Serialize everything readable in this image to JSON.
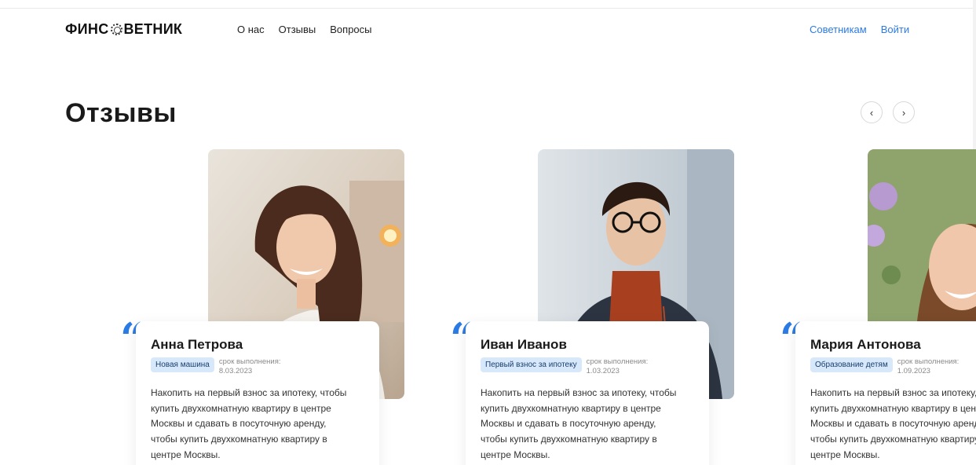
{
  "header": {
    "logo_left": "ФИНС",
    "logo_right": "ВЕТНИК",
    "nav": [
      "О нас",
      "Отзывы",
      "Вопросы"
    ],
    "nav_right": [
      "Советникам",
      "Войти"
    ]
  },
  "section": {
    "title": "Отзывы",
    "prev_icon": "‹",
    "next_icon": "›"
  },
  "reviews": [
    {
      "name": "Анна Петрова",
      "badge": "Новая машина",
      "deadline_label": "срок выполнения:",
      "deadline_date": "8.03.2023",
      "text": "Накопить на первый взнос за ипотеку, чтобы купить двухкомнатную квартиру в центре Москвы и сдавать в посуточную аренду, чтобы купить двухкомнатную квартиру в центре Москвы."
    },
    {
      "name": "Иван Иванов",
      "badge": "Первый взнос за ипотеку",
      "deadline_label": "срок выполнения:",
      "deadline_date": "1.03.2023",
      "text": "Накопить на первый взнос за ипотеку, чтобы купить двухкомнатную квартиру в центре Москвы и сдавать в посуточную аренду, чтобы купить двухкомнатную квартиру в центре Москвы."
    },
    {
      "name": "Мария Антонова",
      "badge": "Образование детям",
      "deadline_label": "срок выполнения:",
      "deadline_date": "1.09.2023",
      "text": "Накопить на первый взнос за ипотеку, чтобы купить двухкомнатную квартиру в центре Москвы и сдавать в посуточную аренду, чтобы купить двухкомнатную квартиру в центре Москвы."
    }
  ],
  "colors": {
    "accent": "#2c7be5",
    "badge_bg": "#d7e8fb"
  }
}
